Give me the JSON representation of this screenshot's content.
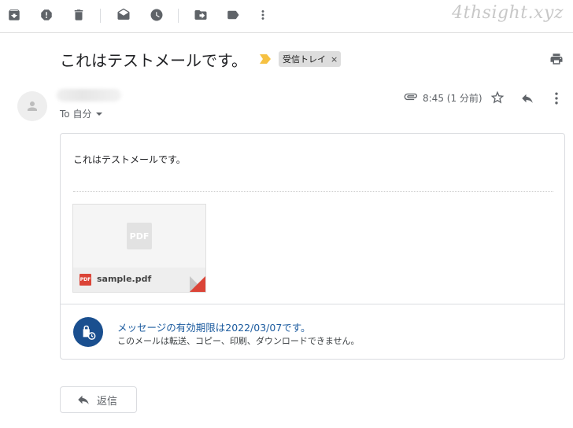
{
  "toolbar": {
    "icons": [
      "archive-icon",
      "report-spam-icon",
      "delete-icon",
      "mark-unread-icon",
      "snooze-icon",
      "move-to-icon",
      "label-icon",
      "more-vert-icon"
    ]
  },
  "watermark": "4thsight.xyz",
  "message": {
    "subject": "これはテストメールです。",
    "label_chip": "受信トレイ",
    "label_remove": "×",
    "to_line": "To 自分",
    "time": "8:45 (1 分前)",
    "body": "これはテストメールです。"
  },
  "attachment": {
    "preview_text": "PDF",
    "type_badge": "PDF",
    "filename": "sample.pdf"
  },
  "confidential": {
    "title": "メッセージの有効期限は2022/03/07です。",
    "subtitle": "このメールは転送、コピー、印刷、ダウンロードできません。"
  },
  "reply_button": {
    "label": "返信"
  },
  "colors": {
    "accent_blue": "#1a4f8f",
    "link_blue": "#1a5a9e",
    "pdf_red": "#db4437",
    "label_yellow": "#f6c142"
  }
}
